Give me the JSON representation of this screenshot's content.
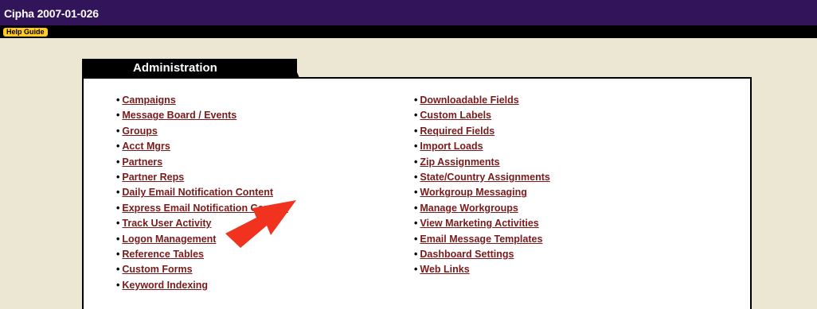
{
  "header": {
    "title": "Cipha 2007-01-026",
    "help_label": "Help Guide"
  },
  "panel": {
    "title": "Administration",
    "left_links": [
      "Campaigns",
      "Message Board / Events",
      "Groups",
      "Acct Mgrs",
      "Partners",
      "Partner Reps",
      "Daily Email Notification Content",
      "Express Email Notification Content",
      "Track User Activity",
      "Logon Management",
      "Reference Tables",
      "Custom Forms",
      "Keyword Indexing"
    ],
    "right_links": [
      "Downloadable Fields",
      "Custom Labels",
      "Required Fields",
      "Import Loads",
      "Zip Assignments",
      "State/Country Assignments",
      "Workgroup Messaging",
      "Manage Workgroups",
      "View Marketing Activities",
      "Email Message Templates",
      "Dashboard Settings",
      "Web Links"
    ]
  },
  "colors": {
    "header_bg": "#32145a",
    "link": "#7a1a1a",
    "help_button": "#ffc926",
    "arrow": "#f0321e",
    "page_bg": "#ebe7d2"
  }
}
